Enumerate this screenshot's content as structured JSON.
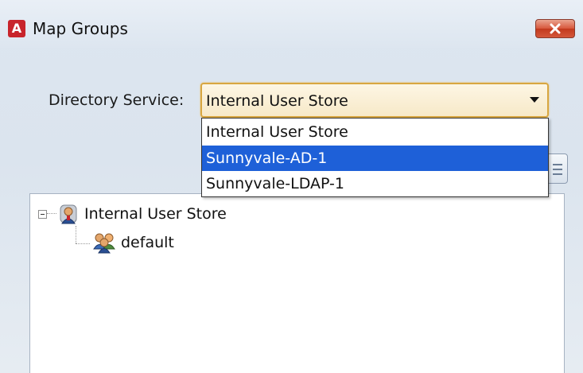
{
  "window": {
    "title": "Map Groups",
    "app_icon_letter": "A",
    "close_icon": "close-x-icon"
  },
  "directory_service": {
    "label": "Directory Service:",
    "selected_value": "Internal User Store",
    "is_open": true,
    "options": [
      {
        "label": "Internal User Store",
        "selected": false
      },
      {
        "label": "Sunnyvale-AD-1",
        "selected": true
      },
      {
        "label": "Sunnyvale-LDAP-1",
        "selected": false
      }
    ]
  },
  "tree": {
    "root": {
      "label": "Internal User Store",
      "icon": "user-store-icon",
      "expanded": true,
      "children": [
        {
          "label": "default",
          "icon": "user-group-icon"
        }
      ]
    }
  },
  "colors": {
    "selection": "#1e60d8",
    "close_button": "#d4573a",
    "app_icon": "#c8242b",
    "select_focus_border": "#d8a640"
  }
}
